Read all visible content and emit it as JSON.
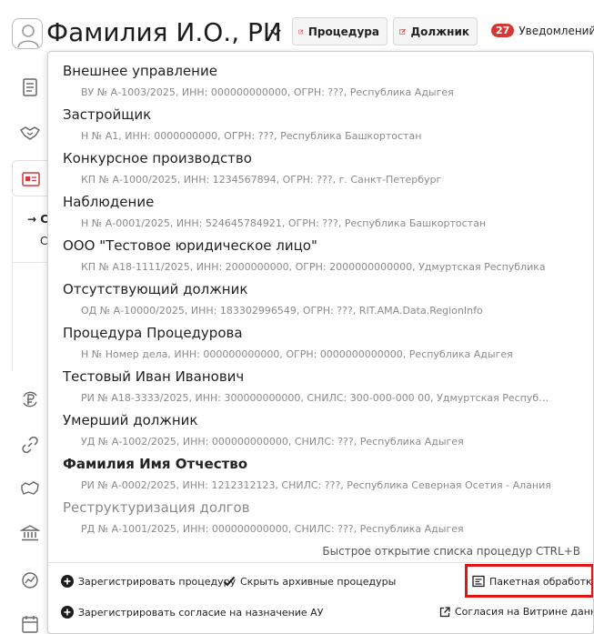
{
  "header": {
    "user_name": "Фамилия И.О., РИ",
    "procedure_button": "Процедура",
    "debtor_button": "Должник",
    "notifications_count": "27",
    "notifications_label": "Уведомлений"
  },
  "sidebar": {
    "partial_text_1": "→ С",
    "partial_text_2": "С"
  },
  "procedures": [
    {
      "title": "Внешнее управление",
      "details": "ВУ № А-1003/2025, ИНН: 000000000000, ОГРН: ???, Республика Адыгея",
      "style": "normal"
    },
    {
      "title": "Застройщик",
      "details": "Н № А1, ИНН: 0000000000, ОГРН: ???, Республика Башкортостан",
      "style": "normal"
    },
    {
      "title": "Конкурсное производство",
      "details": "КП № А-1000/2025, ИНН: 1234567894, ОГРН: ???, г. Санкт-Петербург",
      "style": "normal"
    },
    {
      "title": "Наблюдение",
      "details": "Н № А-0001/2025, ИНН: 524645784921, ОГРН: ???, Республика Башкортостан",
      "style": "normal"
    },
    {
      "title": "ООО \"Тестовое юридическое лицо\"",
      "details": "КП № А18-1111/2025, ИНН: 2000000000, ОГРН: 2000000000000, Удмуртская Республика",
      "style": "normal"
    },
    {
      "title": "Отсутствующий должник",
      "details": "ОД № А-10000/2025, ИНН: 183302996549, ОГРН: ???, RIT.AMA.Data.RegionInfo",
      "style": "normal"
    },
    {
      "title": "Процедура Процедурова",
      "details": "Н № Номер дела, ИНН: 000000000000, ОГРН: 0000000000000, Республика Адыгея",
      "style": "normal"
    },
    {
      "title": "Тестовый Иван Иванович",
      "details": "РИ № А18-3333/2025, ИНН: 300000000000, СНИЛС: 300-000-000 00, Удмуртская Республ...",
      "style": "normal"
    },
    {
      "title": "Умерший должник",
      "details": "УД № А-1002/2025, ИНН: 000000000000, СНИЛС: ???, Республика Адыгея",
      "style": "normal"
    },
    {
      "title": "Фамилия Имя Отчество",
      "details": "РИ № А-0002/2025, ИНН: 1212312123, СНИЛС: ???, Республика Северная Осетия - Алания",
      "style": "bold"
    },
    {
      "title": "Реструктуризация долгов",
      "details": "РД № А-1001/2025, ИНН: 000000000000, СНИЛС: ???, Республика Адыгея",
      "style": "muted"
    }
  ],
  "dropdown": {
    "quick_open_hint": "Быстрое открытие списка процедур CTRL+B",
    "register_procedure": "Зарегистрировать процедуру",
    "hide_archived": "Скрыть архивные процедуры",
    "batch_processing": "Пакетная обработка",
    "register_consent": "Зарегистрировать согласие на назначение АУ",
    "vitrine_consents": "Согласия на Витрине данных"
  },
  "colors": {
    "accent_red": "#d63636",
    "highlight_border": "#e01616",
    "muted_text": "#8a8a8a"
  }
}
